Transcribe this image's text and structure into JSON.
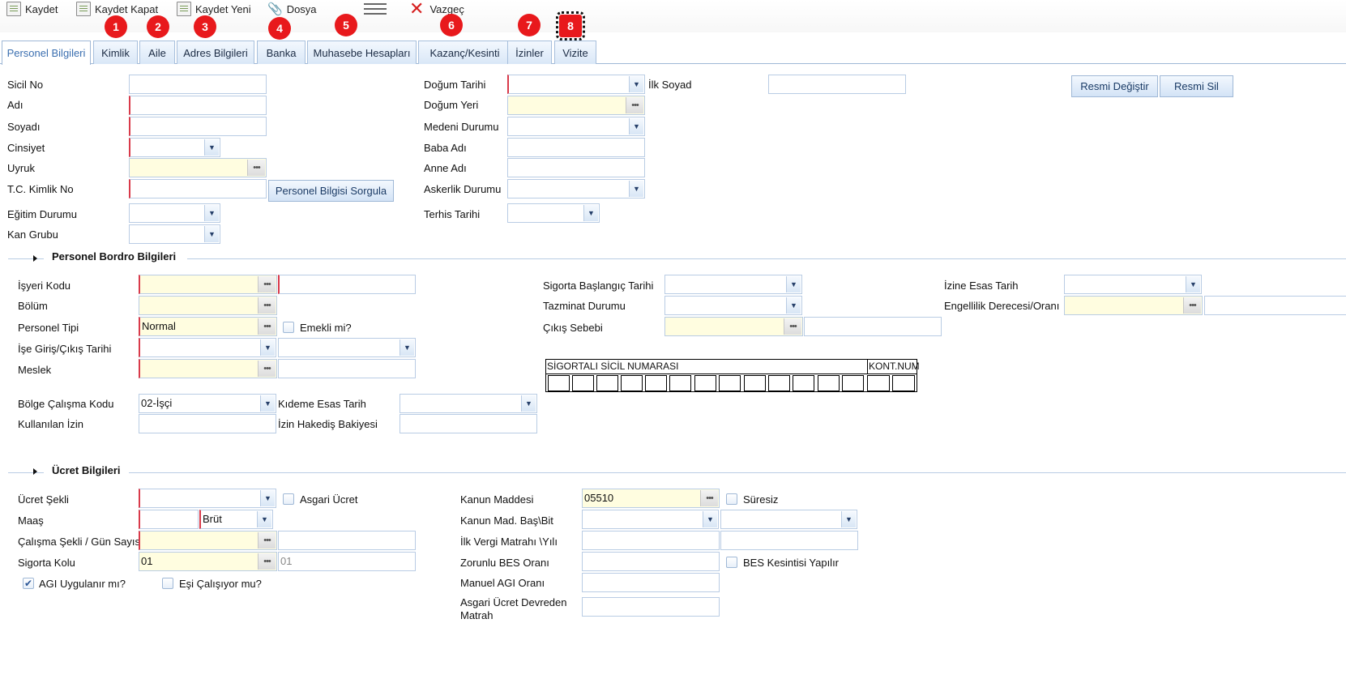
{
  "toolbar": {
    "save": "Kaydet",
    "save_close": "Kaydet Kapat",
    "save_new": "Kaydet Yeni",
    "file": "Dosya",
    "cancel": "Vazgeç"
  },
  "badges": [
    "1",
    "2",
    "3",
    "4",
    "5",
    "6",
    "7",
    "8"
  ],
  "tabs": [
    "Personel Bilgileri",
    "Kimlik",
    "Aile",
    "Adres Bilgileri",
    "Banka",
    "Muhasebe Hesapları",
    "Kazanç/Kesinti",
    "İzinler",
    "Vizite"
  ],
  "personal": {
    "sicil_no": "Sicil No",
    "adi": "Adı",
    "soyadi": "Soyadı",
    "cinsiyet": "Cinsiyet",
    "uyruk": "Uyruk",
    "tc": "T.C. Kimlik No",
    "egitim": "Eğitim Durumu",
    "kan": "Kan Grubu",
    "sorgula": "Personel Bilgisi Sorgula",
    "dogum_tarihi": "Doğum Tarihi",
    "dogum_yeri": "Doğum Yeri",
    "medeni": "Medeni Durumu",
    "baba": "Baba Adı",
    "anne": "Anne Adı",
    "askerlik": "Askerlik Durumu",
    "terhis": "Terhis Tarihi",
    "ilk_soyad": "İlk Soyad",
    "resmi_degistir": "Resmi Değiştir",
    "resmi_sil": "Resmi Sil"
  },
  "bordro": {
    "title": "Personel Bordro Bilgileri",
    "isyeri": "İşyeri Kodu",
    "bolum": "Bölüm",
    "tip": "Personel Tipi",
    "tip_value": "Normal",
    "emekli": "Emekli mi?",
    "giris": "İşe Giriş/Çıkış Tarihi",
    "meslek": "Meslek",
    "bolge": "Bölge Çalışma Kodu",
    "bolge_value": "02-İşçi",
    "kideme": "Kıdeme Esas Tarih",
    "kullanilan": "Kullanılan İzin",
    "hakedis": "İzin Hakediş Bakiyesi",
    "sig_baslangic": "Sigorta Başlangıç Tarihi",
    "tazminat": "Tazminat Durumu",
    "cikis_sebebi": "Çıkış Sebebi",
    "izine_esas": "İzine Esas Tarih",
    "engellilik": "Engellilik Derecesi/Oranı",
    "sigortali_header": "SİGORTALI SİCİL NUMARASI",
    "kont_header": "KONT.NUM"
  },
  "ucret": {
    "title": "Ücret Bilgileri",
    "sekli": "Ücret Şekli",
    "asgari": "Asgari Ücret",
    "maas": "Maaş",
    "brut": "Brüt",
    "calisma": "Çalışma Şekli / Gün Sayısı",
    "kolu": "Sigorta Kolu",
    "kolu_value": "01",
    "kolu_value2": "01",
    "agi": "AGI Uygulanır mı?",
    "esi": "Eşi Çalışıyor mu?",
    "kanun": "Kanun Maddesi",
    "kanun_value": "05510",
    "suresiz": "Süresiz",
    "kanun_bas": "Kanun Mad. Baş\\Bit",
    "ilk_vergi": "İlk Vergi Matrahı \\Yılı",
    "bes_orani": "Zorunlu BES Oranı",
    "bes_kesinti": "BES Kesintisi Yapılır",
    "manuel_agi": "Manuel AGI Oranı",
    "asgari_devreden1": "Asgari Ücret Devreden",
    "asgari_devreden2": "Matrah"
  },
  "colors": {
    "badge": "#e8191c",
    "required": "#d93a4a",
    "lookup_bg": "#fffde0",
    "tab_active_text": "#3b6fb0"
  }
}
